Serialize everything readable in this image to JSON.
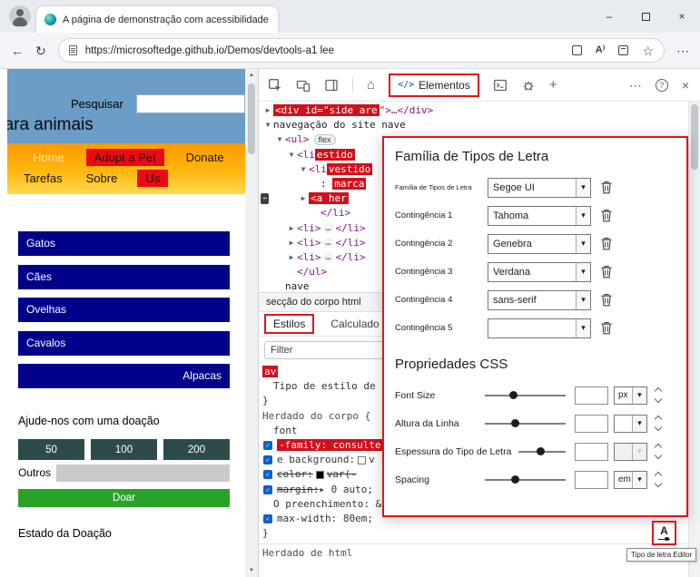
{
  "colors": {
    "annotation_red": "#e0151b",
    "header_blue": "#6b9dc6",
    "nav_red": "#ea0b12",
    "category_navy": "#00008b",
    "amount_slate": "#2e4b4b",
    "donate_green": "#2aa22a",
    "search_highlight_red": "#d2101c"
  },
  "icons": {
    "back": "←",
    "refresh": "↻",
    "more": "⋯",
    "help": "?",
    "close": "×",
    "minimize": "–",
    "home": "⌂",
    "code": "</>",
    "add": "+",
    "star": "☆",
    "read_aloud": "A⁾",
    "check": "✓",
    "arrow_up": "▲",
    "arrow_down": "▼",
    "dd_arrow": "▾",
    "font_editor": "A"
  },
  "titlebar": {
    "tab_title": "A página de demonstração com acessibilidade é"
  },
  "addressbar": {
    "url": "https://microsoftedge.github.io/Demos/devtools-a1 lee"
  },
  "page": {
    "search_label": "Pesquisar",
    "heading": "para animais",
    "nav_row1": [
      {
        "label": "Home",
        "highlight": false,
        "gold": true
      },
      {
        "label": "Adopt a Pet",
        "highlight": true,
        "gold": false
      },
      {
        "label": "Donate",
        "highlight": false,
        "gold": false
      }
    ],
    "nav_row2": [
      {
        "label": "Tarefas",
        "highlight": false,
        "gold": false
      },
      {
        "label": "Sobre",
        "highlight": false,
        "gold": false
      },
      {
        "label": "Us",
        "highlight": true,
        "gold": false
      }
    ],
    "categories": [
      "Gatos",
      "Cães",
      "Ovelhas",
      "Cavalos",
      "Alpacas"
    ],
    "donation": {
      "heading": "Ajude-nos com uma doação",
      "amounts": [
        "50",
        "100",
        "200"
      ],
      "other_label": "Outros",
      "donate_label": "Doar",
      "status_heading": "Estado da Doação"
    }
  },
  "devtools": {
    "toolbar": {
      "elements_label": "Elementos"
    },
    "breadcrumb": "secção do corpo html",
    "tabs": {
      "styles": "Estilos",
      "computed": "Calculado"
    },
    "filter_placeholder": "Filter",
    "dom_tree": [
      {
        "indent": 0,
        "arrow": "▶",
        "tokens": [
          {
            "t": "<div id=\"side are",
            "c": "hl"
          },
          {
            "t": "\">…</div>",
            "c": "tag"
          }
        ]
      },
      {
        "indent": 0,
        "arrow": "▼",
        "tokens": [
          {
            "t": "navegação do site nave",
            "c": "text"
          }
        ]
      },
      {
        "indent": 1,
        "arrow": "▼",
        "tokens": [
          {
            "t": "<ul>",
            "c": "tag"
          },
          {
            "t": "flex",
            "c": "badge"
          }
        ]
      },
      {
        "indent": 2,
        "arrow": "▼",
        "tokens": [
          {
            "t": "<li",
            "c": "tag"
          },
          {
            "t": "estido",
            "c": "hl"
          }
        ]
      },
      {
        "indent": 3,
        "arrow": "▼",
        "tokens": [
          {
            "t": "<li",
            "c": "tag"
          },
          {
            "t": "vestido",
            "c": "hl"
          }
        ]
      },
      {
        "indent": 4,
        "arrow": "",
        "tokens": [
          {
            "t": ": ",
            "c": "text"
          },
          {
            "t": "marca",
            "c": "hl"
          }
        ]
      },
      {
        "indent": 3,
        "arrow": "▶",
        "gutter": "⋯",
        "tokens": [
          {
            "t": "<a her",
            "c": "hl"
          }
        ]
      },
      {
        "indent": 4,
        "arrow": "",
        "tokens": [
          {
            "t": "</li>",
            "c": "tag"
          }
        ]
      },
      {
        "indent": 2,
        "arrow": "▶",
        "tokens": [
          {
            "t": "<li>",
            "c": "tag"
          },
          {
            "t": "…",
            "c": "ell"
          },
          {
            "t": "</li>",
            "c": "tag"
          }
        ]
      },
      {
        "indent": 2,
        "arrow": "▶",
        "tokens": [
          {
            "t": "<li>",
            "c": "tag"
          },
          {
            "t": "…",
            "c": "ell"
          },
          {
            "t": "</li>",
            "c": "tag"
          }
        ]
      },
      {
        "indent": 2,
        "arrow": "▶",
        "tokens": [
          {
            "t": "<li>",
            "c": "tag"
          },
          {
            "t": "…",
            "c": "ell"
          },
          {
            "t": "</li>",
            "c": "tag"
          }
        ]
      },
      {
        "indent": 2,
        "arrow": "",
        "tokens": [
          {
            "t": "</ul>",
            "c": "tag"
          }
        ]
      },
      {
        "indent": 1,
        "arrow": "",
        "tokens": [
          {
            "t": "nave",
            "c": "text"
          }
        ]
      }
    ],
    "styles_lines": [
      {
        "indent": 0,
        "tokens": [
          {
            "t": "av",
            "c": "hl"
          }
        ]
      },
      {
        "indent": 1,
        "tokens": [
          {
            "t": "Tipo de estilo de lista:",
            "c": "prop"
          }
        ]
      },
      {
        "indent": 0,
        "tokens": [
          {
            "t": "}",
            "c": "prop"
          }
        ]
      },
      {
        "indent": 0,
        "tokens": [
          {
            "t": "Herdado do corpo {",
            "c": "section"
          }
        ]
      },
      {
        "indent": 1,
        "tokens": [
          {
            "t": "font",
            "c": "prop"
          }
        ]
      },
      {
        "check": true,
        "tokens": [
          {
            "t": "-family: consulte",
            "c": "hl"
          }
        ]
      },
      {
        "check": true,
        "tokens": [
          {
            "t": "e background:",
            "c": "prop"
          },
          {
            "t": "#ffffff",
            "c": "swatch"
          },
          {
            "t": "v",
            "c": "val"
          }
        ]
      },
      {
        "check": true,
        "tokens": [
          {
            "t": "color:",
            "c": "prop strike"
          },
          {
            "t": "#000000",
            "c": "swatch"
          },
          {
            "t": "var(-",
            "c": "val strike"
          }
        ]
      },
      {
        "check": true,
        "tokens": [
          {
            "t": "margin:",
            "c": "prop strike"
          },
          {
            "t": "▸ 0 auto;",
            "c": "val"
          }
        ]
      },
      {
        "indent": 1,
        "tokens": [
          {
            "t": "O preenchimento: &gt; e;",
            "c": "prop"
          }
        ]
      },
      {
        "check": true,
        "tokens": [
          {
            "t": "max-width: 80em;",
            "c": "prop"
          }
        ]
      },
      {
        "indent": 0,
        "tokens": [
          {
            "t": "}",
            "c": "prop"
          }
        ]
      },
      {
        "indent": 0,
        "sep": true,
        "tokens": [
          {
            "t": "Herdado de html",
            "c": "section"
          }
        ]
      }
    ]
  },
  "font_editor": {
    "title": "Família de Tipos de Letra",
    "family_rows": [
      {
        "label": "Família de Tipos de Letra",
        "value": "Segoe UI"
      },
      {
        "label": "Contingência 1",
        "value": "Tahoma"
      },
      {
        "label": "Contingência 2",
        "value": "Genebra"
      },
      {
        "label": "Contingência 3",
        "value": "Verdana"
      },
      {
        "label": "Contingência 4",
        "value": "sans-serif"
      },
      {
        "label": "Contingência 5",
        "value": ""
      }
    ],
    "css_title": "Propriedades CSS",
    "css_rows": [
      {
        "label": "Font Size",
        "unit": "px",
        "disabled": false,
        "pos": 30
      },
      {
        "label": "Altura da Linha",
        "unit": "",
        "disabled": false,
        "pos": 33
      },
      {
        "label": "Espessura do Tipo de Letra",
        "unit": "",
        "disabled": true,
        "pos": 38
      },
      {
        "label": "Spacing",
        "unit": "em",
        "disabled": false,
        "pos": 33
      }
    ]
  },
  "tooltip": "Tipo de letra Editor"
}
